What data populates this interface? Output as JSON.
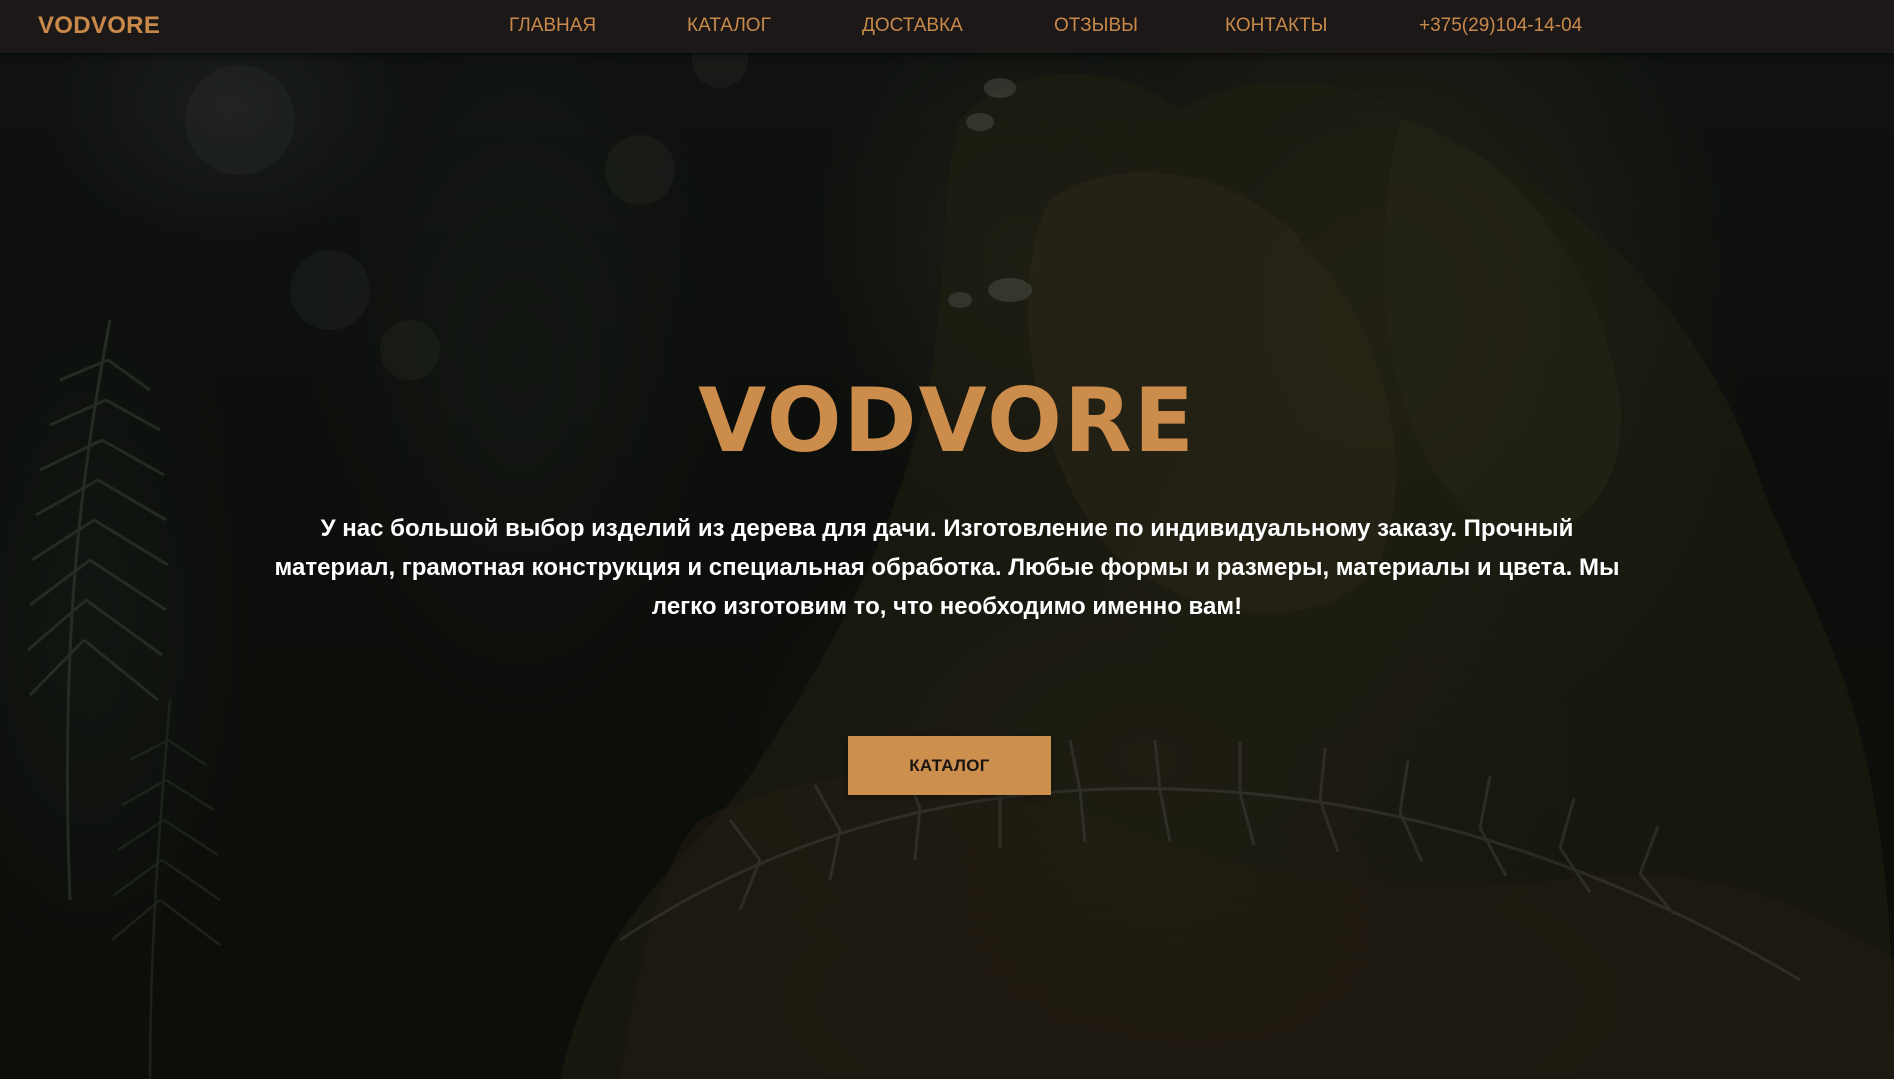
{
  "brand": {
    "logo_text": "VODVORE"
  },
  "nav": {
    "items": [
      {
        "label": "ГЛАВНАЯ"
      },
      {
        "label": "КАТАЛОГ"
      },
      {
        "label": "ДОСТАВКА"
      },
      {
        "label": "ОТЗЫВЫ"
      },
      {
        "label": "КОНТАКТЫ"
      }
    ],
    "phone": "+375(29)104-14-04"
  },
  "hero": {
    "title": "VODVORE",
    "description": "У нас большой выбор изделий из дерева для дачи. Изготовление по индивидуальному заказу. Прочный материал, грамотная конструкция и специальная обработка. Любые формы и размеры, материалы и цвета. Мы легко изготовим то, что необходимо именно вам!",
    "cta_label": "КАТАЛОГ"
  },
  "colors": {
    "accent": "#cc8c4b",
    "navbar_bg": "#1c1817",
    "text_light": "#ffffff"
  }
}
